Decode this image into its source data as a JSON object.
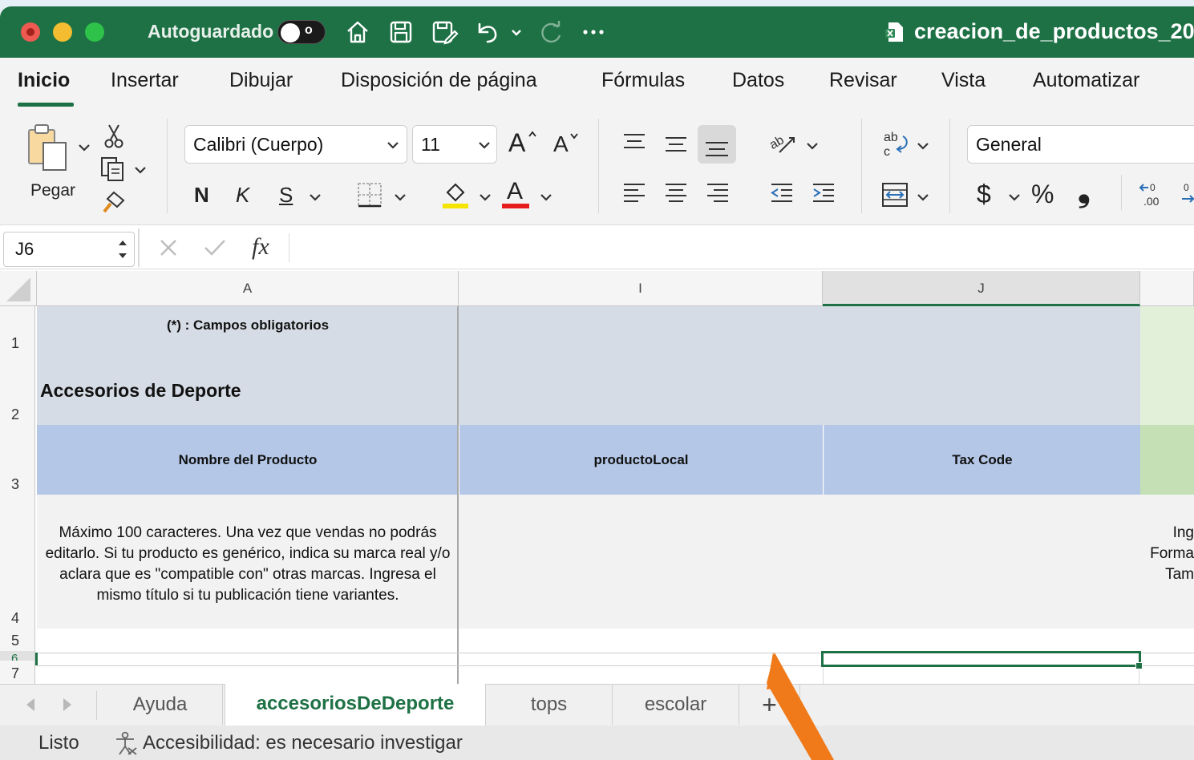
{
  "titlebar": {
    "autosave_label": "Autoguardado",
    "autosave_state": "o",
    "doc_title": "creacion_de_productos_20",
    "colors": {
      "bar": "#1e7145"
    }
  },
  "ribbon_tabs": [
    "Inicio",
    "Insertar",
    "Dibujar",
    "Disposición de página",
    "Fórmulas",
    "Datos",
    "Revisar",
    "Vista",
    "Automatizar"
  ],
  "clipboard": {
    "paste_label": "Pegar"
  },
  "font": {
    "family": "Calibri (Cuerpo)",
    "size": "11",
    "bold": "N",
    "italic": "K",
    "underline": "S",
    "grow": "A",
    "shrink": "A",
    "font_color_glyph": "A"
  },
  "number": {
    "format": "General",
    "currency": "$",
    "percent": "%",
    "comma": "❟"
  },
  "formula_bar": {
    "name_box": "J6",
    "fx": "fx",
    "content": ""
  },
  "columns": [
    "A",
    "I",
    "J"
  ],
  "rows": [
    "1",
    "2",
    "3",
    "4",
    "5",
    "6",
    "7"
  ],
  "cells": {
    "a1": "(*) : Campos obligatorios",
    "a2": "Accesorios de Deporte",
    "a3": "Nombre del Producto",
    "i3": "productoLocal",
    "j3": "Tax Code",
    "a4": "Máximo 100 caracteres. Una vez que vendas no podrás editarlo. Si tu producto es genérico, indica su marca real y/o aclara que es \"compatible con\" otras marcas. Ingresa el mismo título si tu publicación tiene variantes.",
    "k4": "Ing\nForma\nTam"
  },
  "sheet_tabs": [
    "Ayuda",
    "accesoriosDeDeporte",
    "tops",
    "escolar"
  ],
  "add_sheet": "+",
  "status": {
    "ready": "Listo",
    "accessibility": "Accesibilidad: es necesario investigar"
  },
  "colors": {
    "accent": "#1e7145",
    "header_fill": "#b4c7e7",
    "title_fill": "#d6dce5",
    "green_fill": "#e2efd9",
    "green_header": "#c5e0b4",
    "annotation_arrow": "#f07a1a"
  }
}
